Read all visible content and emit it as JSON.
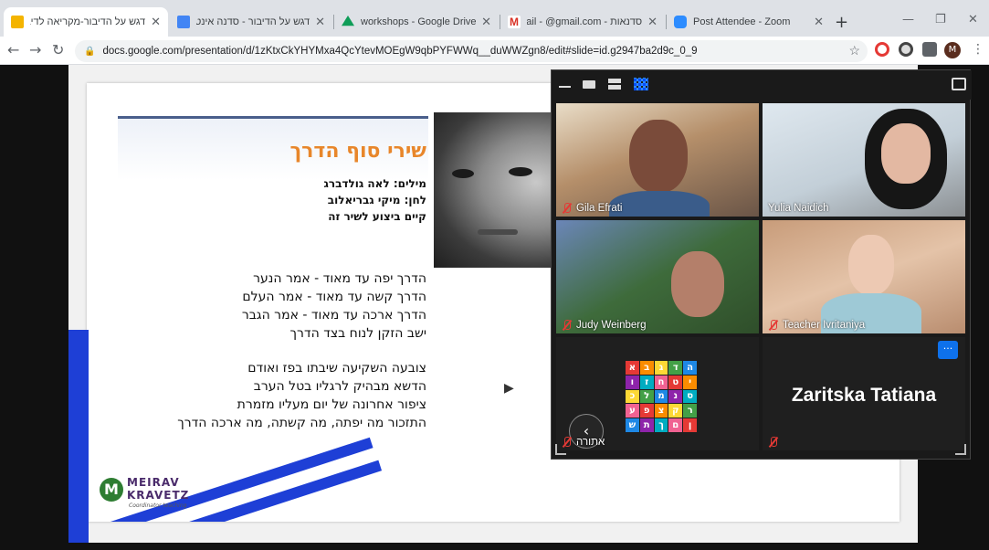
{
  "browser": {
    "tabs": [
      {
        "title": "דגש על הדיבור-מקריאה לדיבור",
        "favicon_color": "#f4b400",
        "active": true
      },
      {
        "title": "דגש על הדיבור - סדנה אינטראקטיבית",
        "favicon_color": "#4285f4",
        "active": false
      },
      {
        "title": "workshops - Google Drive",
        "favicon_color": "#0f9d58",
        "active": false
      },
      {
        "title": "סדנאות - Gmail - @gmail.com",
        "favicon_color": "#d93025",
        "active": false
      },
      {
        "title": "Post Attendee - Zoom",
        "favicon_color": "#2d8cff",
        "active": false
      }
    ],
    "new_tab": "+",
    "minimize": "—",
    "maximize": "❐",
    "close": "✕",
    "tab_close": "✕",
    "back": "←",
    "forward": "→",
    "reload": "↻",
    "url": "docs.google.com/presentation/d/1zKtxCkYHYMxa4QcYtevMOEgW9qbPYFWWq__duWWZgn8/edit#slide=id.g2947ba2d9c_0_9",
    "lock": "🔒",
    "star": "☆",
    "avatar_letter": "M",
    "more": "⋮"
  },
  "slide": {
    "title": "שירי סוף הדרך",
    "credits": [
      "מילים: לאה גולדברג",
      "לחן: מיקי גבריאלוב",
      "קיים ביצוע לשיר זה"
    ],
    "stanza1": [
      "הדרך יפה עד מאוד - אמר הנער",
      "הדרך קשה עד מאוד - אמר העלם",
      "הדרך ארכה עד מאוד - אמר הגבר",
      "ישב הזקן לנוח בצד הדרך"
    ],
    "stanza2": [
      "צובעה השקיעה שיבתו בפז ואודם",
      "הדשא מבהיק לרגליו בטל הערב",
      "ציפור אחרונה של יום מעליו מזמרת",
      "התזכור מה יפתה, מה קשתה, מה ארכה הדרך"
    ],
    "logo": {
      "letter": "M",
      "line1": "MEIRAV",
      "line2": "KRAVETZ",
      "tagline": "Coordinator teaching"
    },
    "accent_color": "#e8862a",
    "stripe_color": "#1e3fd6"
  },
  "zoom": {
    "participants": [
      {
        "name": "Gila Efrati",
        "muted": true
      },
      {
        "name": "Yulia Naidich",
        "muted": false
      },
      {
        "name": "Judy Weinberg",
        "muted": true
      },
      {
        "name": "Teacher Ivritaniya",
        "muted": true
      },
      {
        "name": "אתורה",
        "muted": true
      },
      {
        "name": "Zaritska Tatiana",
        "muted": true
      }
    ],
    "more_label": "···",
    "prev_label": "‹",
    "alphabet": [
      "א",
      "ב",
      "ג",
      "ד",
      "ה",
      "ו",
      "ז",
      "ח",
      "ט",
      "י",
      "כ",
      "ל",
      "מ",
      "נ",
      "ס",
      "ע",
      "פ",
      "צ",
      "ק",
      "ר",
      "ש",
      "ת",
      "ך",
      "ם",
      "ן"
    ]
  }
}
